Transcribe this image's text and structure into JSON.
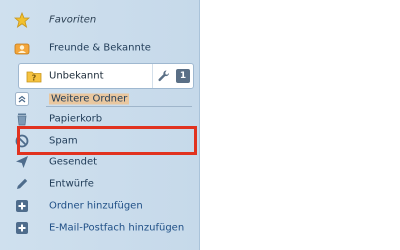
{
  "sidebar": {
    "items": [
      {
        "id": "favoriten",
        "label": "Favoriten",
        "icon": "star-icon"
      },
      {
        "id": "freunde",
        "label": "Freunde & Bekannte",
        "icon": "contact-card-icon"
      },
      {
        "id": "unbekannt",
        "label": "Unbekannt",
        "icon": "folder-question-icon",
        "selected": true
      },
      {
        "id": "weitere",
        "label": "Weitere Ordner",
        "icon": "collapse-icon"
      },
      {
        "id": "papierkorb",
        "label": "Papierkorb",
        "icon": "trash-icon"
      },
      {
        "id": "spam",
        "label": "Spam",
        "icon": "blocked-icon"
      },
      {
        "id": "gesendet",
        "label": "Gesendet",
        "icon": "send-icon"
      },
      {
        "id": "entwuerfe",
        "label": "Entwürfe",
        "icon": "pencil-icon"
      },
      {
        "id": "ordner_add",
        "label": "Ordner hinzufügen",
        "icon": "plus-icon"
      },
      {
        "id": "postfach_add",
        "label": "E-Mail-Postfach hinzufügen",
        "icon": "plus-icon"
      }
    ],
    "unbekannt_actions": {
      "wrench_icon": "wrench-icon",
      "contact_icon": "contact-icon",
      "contact_glyph": "1"
    }
  },
  "colors": {
    "sidebar_bg": "#cfe0ee",
    "highlight_border": "#e1321f",
    "section_highlight": "#e9c79f",
    "link_text": "#1f4f86"
  }
}
